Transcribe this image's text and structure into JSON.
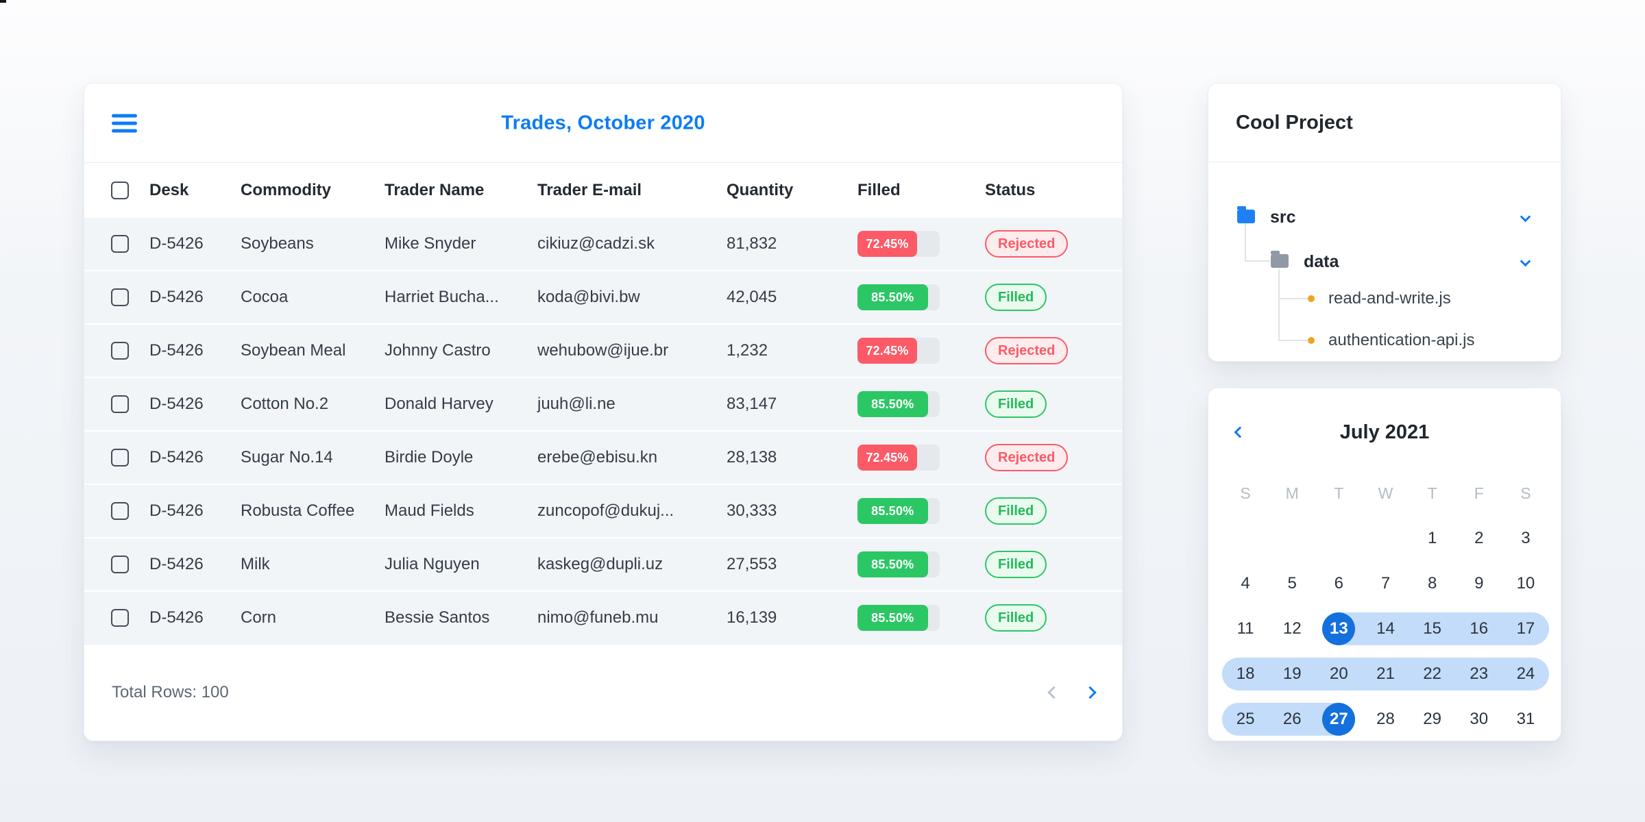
{
  "palette": {
    "accent_blue": "#0d7cf5",
    "deep_blue": "#1470dc",
    "range_blue": "#c3dcf9",
    "green": "#2bc764",
    "green_bg": "#eafaef",
    "red": "#fb5a66",
    "red_bg": "#fdeced",
    "orange_dot": "#f0a41f"
  },
  "trades": {
    "title": "Trades, October 2020",
    "columns": [
      "Desk",
      "Commodity",
      "Trader Name",
      "Trader E-mail",
      "Quantity",
      "Filled",
      "Status"
    ],
    "rows": [
      {
        "desk": "D-5426",
        "commodity": "Soybeans",
        "trader_name": "Mike Snyder",
        "trader_email": "cikiuz@cadzi.sk",
        "quantity": "81,832",
        "filled_label": "72.45%",
        "filled_pct": 72.45,
        "filled_color": "red",
        "status": "Rejected"
      },
      {
        "desk": "D-5426",
        "commodity": "Cocoa",
        "trader_name": "Harriet Bucha...",
        "trader_email": "koda@bivi.bw",
        "quantity": "42,045",
        "filled_label": "85.50%",
        "filled_pct": 85.5,
        "filled_color": "green",
        "status": "Filled"
      },
      {
        "desk": "D-5426",
        "commodity": "Soybean Meal",
        "trader_name": "Johnny Castro",
        "trader_email": "wehubow@ijue.br",
        "quantity": "1,232",
        "filled_label": "72.45%",
        "filled_pct": 72.45,
        "filled_color": "red",
        "status": "Rejected"
      },
      {
        "desk": "D-5426",
        "commodity": "Cotton No.2",
        "trader_name": "Donald Harvey",
        "trader_email": "juuh@li.ne",
        "quantity": "83,147",
        "filled_label": "85.50%",
        "filled_pct": 85.5,
        "filled_color": "green",
        "status": "Filled"
      },
      {
        "desk": "D-5426",
        "commodity": "Sugar No.14",
        "trader_name": "Birdie Doyle",
        "trader_email": "erebe@ebisu.kn",
        "quantity": "28,138",
        "filled_label": "72.45%",
        "filled_pct": 72.45,
        "filled_color": "red",
        "status": "Rejected"
      },
      {
        "desk": "D-5426",
        "commodity": "Robusta Coffee",
        "trader_name": "Maud Fields",
        "trader_email": "zuncopof@dukuj...",
        "quantity": "30,333",
        "filled_label": "85.50%",
        "filled_pct": 85.5,
        "filled_color": "green",
        "status": "Filled"
      },
      {
        "desk": "D-5426",
        "commodity": "Milk",
        "trader_name": "Julia Nguyen",
        "trader_email": "kaskeg@dupli.uz",
        "quantity": "27,553",
        "filled_label": "85.50%",
        "filled_pct": 85.5,
        "filled_color": "green",
        "status": "Filled"
      },
      {
        "desk": "D-5426",
        "commodity": "Corn",
        "trader_name": "Bessie Santos",
        "trader_email": "nimo@funeb.mu",
        "quantity": "16,139",
        "filled_label": "85.50%",
        "filled_pct": 85.5,
        "filled_color": "green",
        "status": "Filled"
      }
    ],
    "footer": {
      "total_label": "Total Rows: 100"
    }
  },
  "project": {
    "title": "Cool Project",
    "tree": {
      "src_label": "src",
      "data_label": "data",
      "files": [
        "read-and-write.js",
        "authentication-api.js"
      ]
    }
  },
  "calendar": {
    "title": "July 2021",
    "day_headers": [
      "S",
      "M",
      "T",
      "W",
      "T",
      "F",
      "S"
    ],
    "weeks": [
      [
        null,
        null,
        null,
        null,
        1,
        2,
        3
      ],
      [
        4,
        5,
        6,
        7,
        8,
        9,
        10
      ],
      [
        11,
        12,
        13,
        14,
        15,
        16,
        17
      ],
      [
        18,
        19,
        20,
        21,
        22,
        23,
        24
      ],
      [
        25,
        26,
        27,
        28,
        29,
        30,
        31
      ]
    ],
    "range_start": 13,
    "range_end": 27,
    "selected_days": [
      13,
      27
    ]
  }
}
